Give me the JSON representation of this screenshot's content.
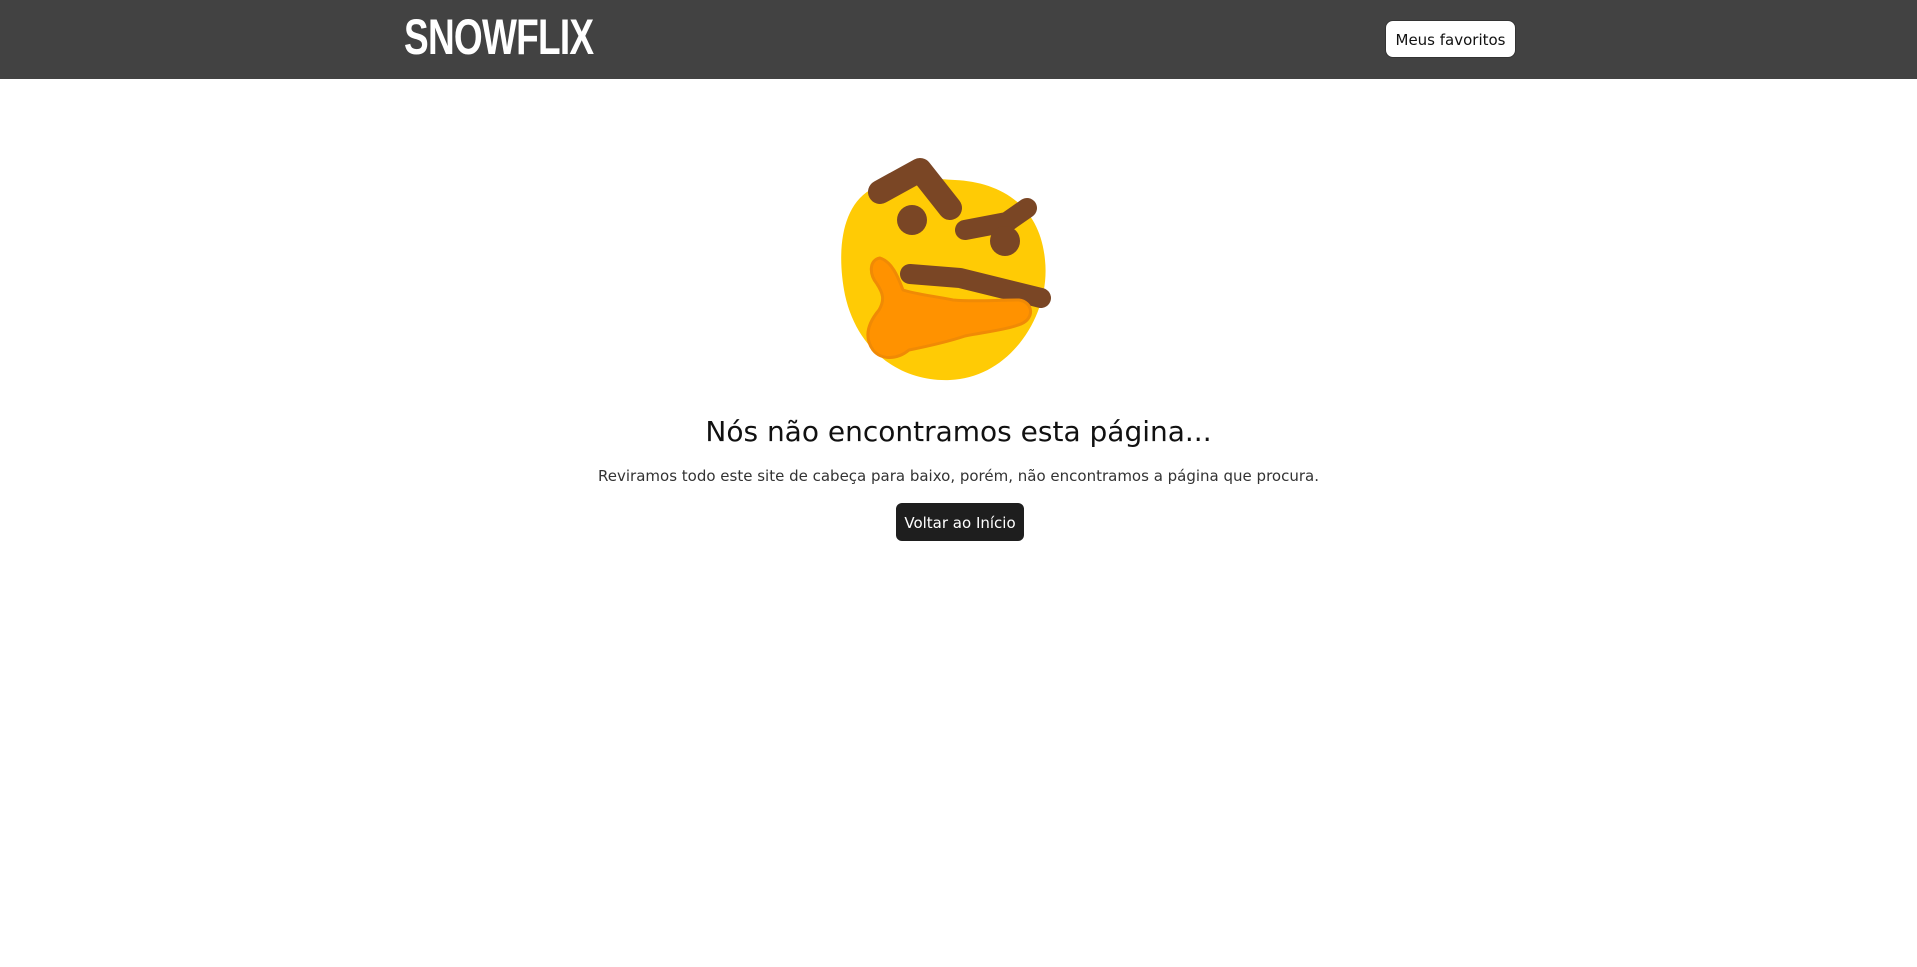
{
  "header": {
    "logo_text": "SNOWFLIX",
    "favorites_label": "Meus favoritos"
  },
  "not_found": {
    "illustration_icon": "thinking-face-icon",
    "title": "Nós não encontramos esta página...",
    "message": "Reviramos todo este site de cabeça para baixo, porém, não encontramos a página que procura.",
    "home_button_label": "Voltar ao Início"
  },
  "colors": {
    "header_background": "#424242",
    "face_yellow": "#FFCB05",
    "hand_orange": "#FF9200",
    "feature_brown": "#7A4625",
    "button_dark": "#1e1e1e"
  }
}
